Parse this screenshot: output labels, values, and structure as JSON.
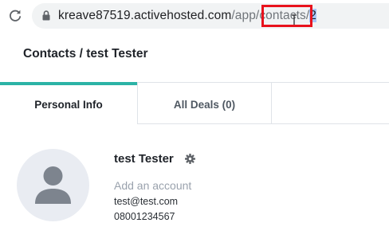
{
  "browser": {
    "url_host": "kreave87519.activehosted.com",
    "url_path_prefix": "/app/contacts/",
    "url_path_selected": "2",
    "icons": {
      "reload": "reload-icon",
      "lock": "lock-icon"
    },
    "highlight_color": "#e8121c"
  },
  "page": {
    "title": "Contacts / test Tester"
  },
  "tabs": [
    {
      "label": "Personal Info",
      "active": true
    },
    {
      "label": "All Deals (0)",
      "active": false
    }
  ],
  "contact": {
    "name": "test Tester",
    "add_account_label": "Add an account",
    "email": "test@test.com",
    "phone": "08001234567",
    "icons": {
      "avatar": "user-avatar-icon",
      "settings": "gear-icon"
    }
  },
  "colors": {
    "accent": "#2cb3a6",
    "muted_text": "#9aa2ad"
  }
}
